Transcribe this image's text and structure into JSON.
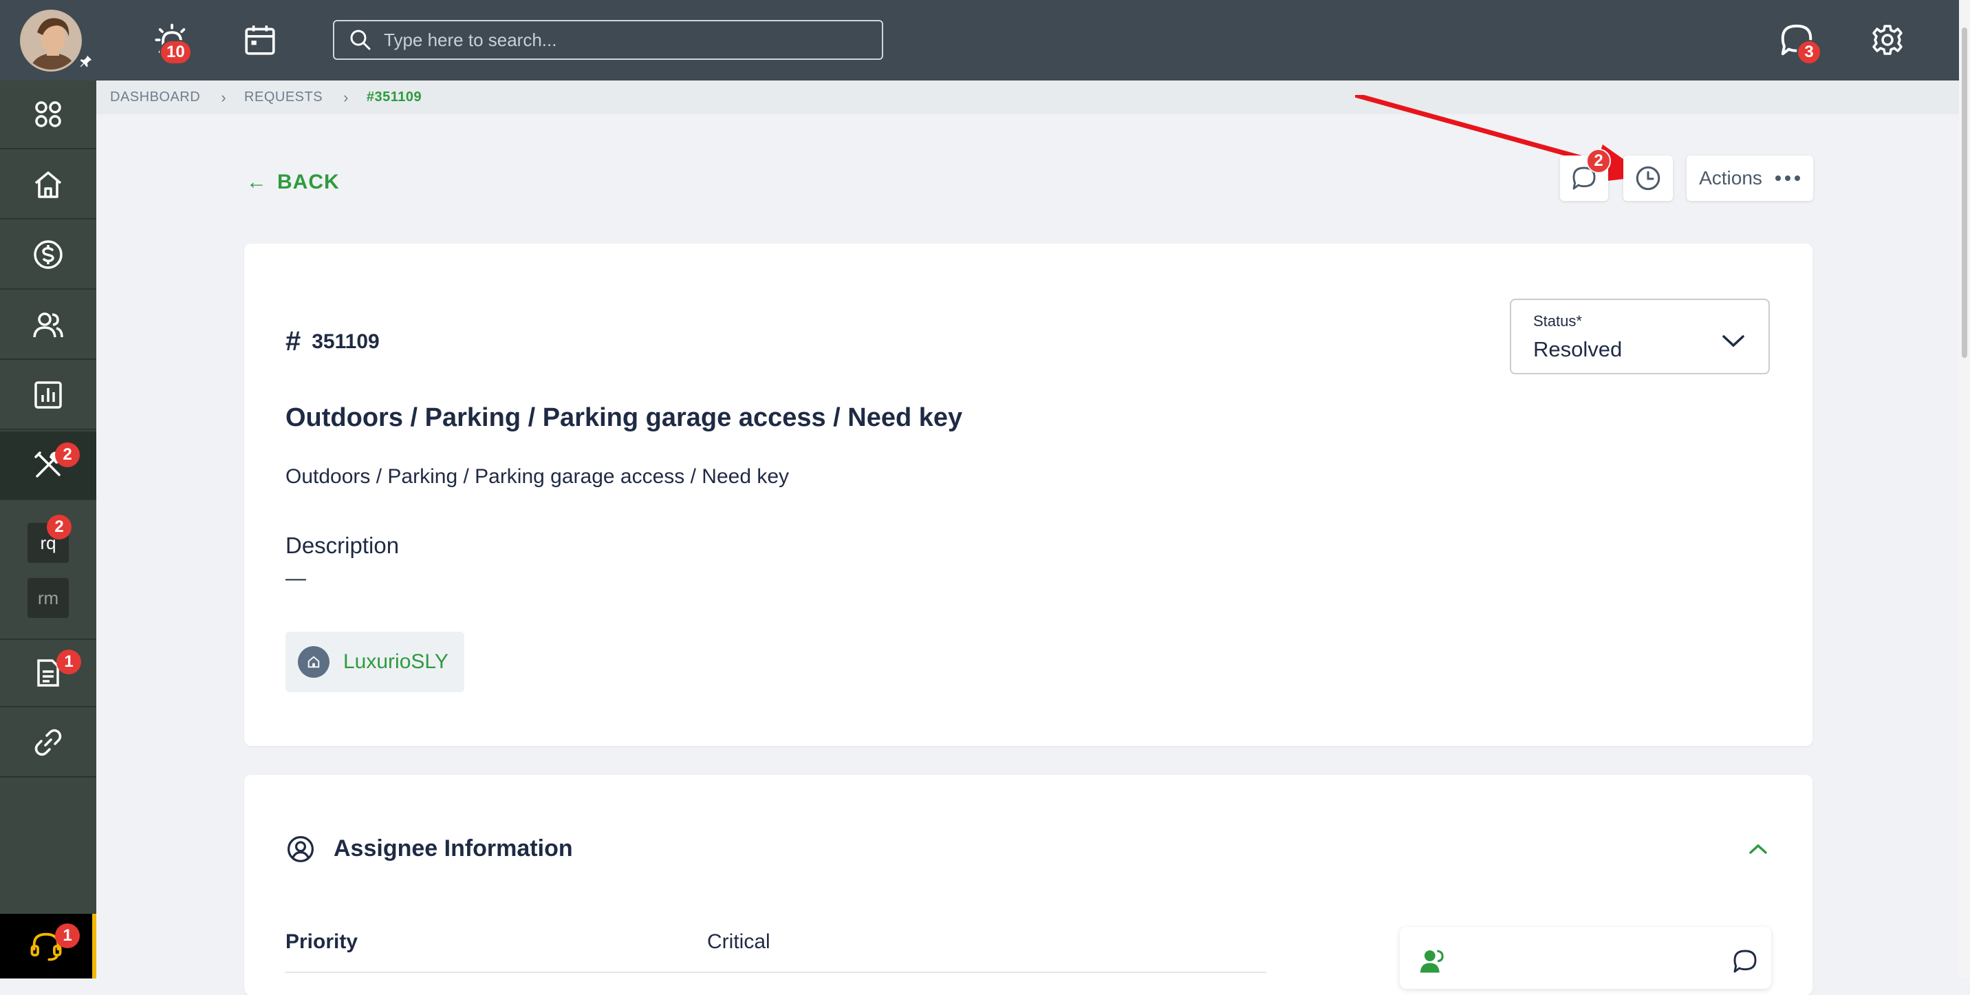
{
  "topbar": {
    "alarm_badge": "10",
    "search_placeholder": "Type here to search...",
    "chat_badge": "3"
  },
  "sidebar": {
    "tools_badge": "2",
    "rq_label": "rq",
    "rq_badge": "2",
    "rm_label": "rm",
    "docs_badge": "1",
    "support_badge": "1"
  },
  "breadcrumb": {
    "items": [
      "DASHBOARD",
      "REQUESTS",
      "#351109"
    ]
  },
  "toolbar": {
    "back_label": "BACK",
    "comments_badge": "2",
    "actions_label": "Actions"
  },
  "request": {
    "number": "351109",
    "title": "Outdoors / Parking / Parking garage access / Need key",
    "category_path": "Outdoors / Parking / Parking garage access / Need key",
    "description_label": "Description",
    "description_value": "—",
    "property_chip": "LuxurioSLY",
    "status": {
      "label": "Status*",
      "value": "Resolved"
    }
  },
  "assignee": {
    "section_title": "Assignee Information",
    "priority_label": "Priority",
    "priority_value": "Critical"
  },
  "colors": {
    "accent_green": "#2e9b3e",
    "badge_red": "#e53935",
    "topbar_bg": "#3f4a52",
    "sidebar_bg": "#3b4740",
    "annotation_arrow": "#e8141b"
  }
}
